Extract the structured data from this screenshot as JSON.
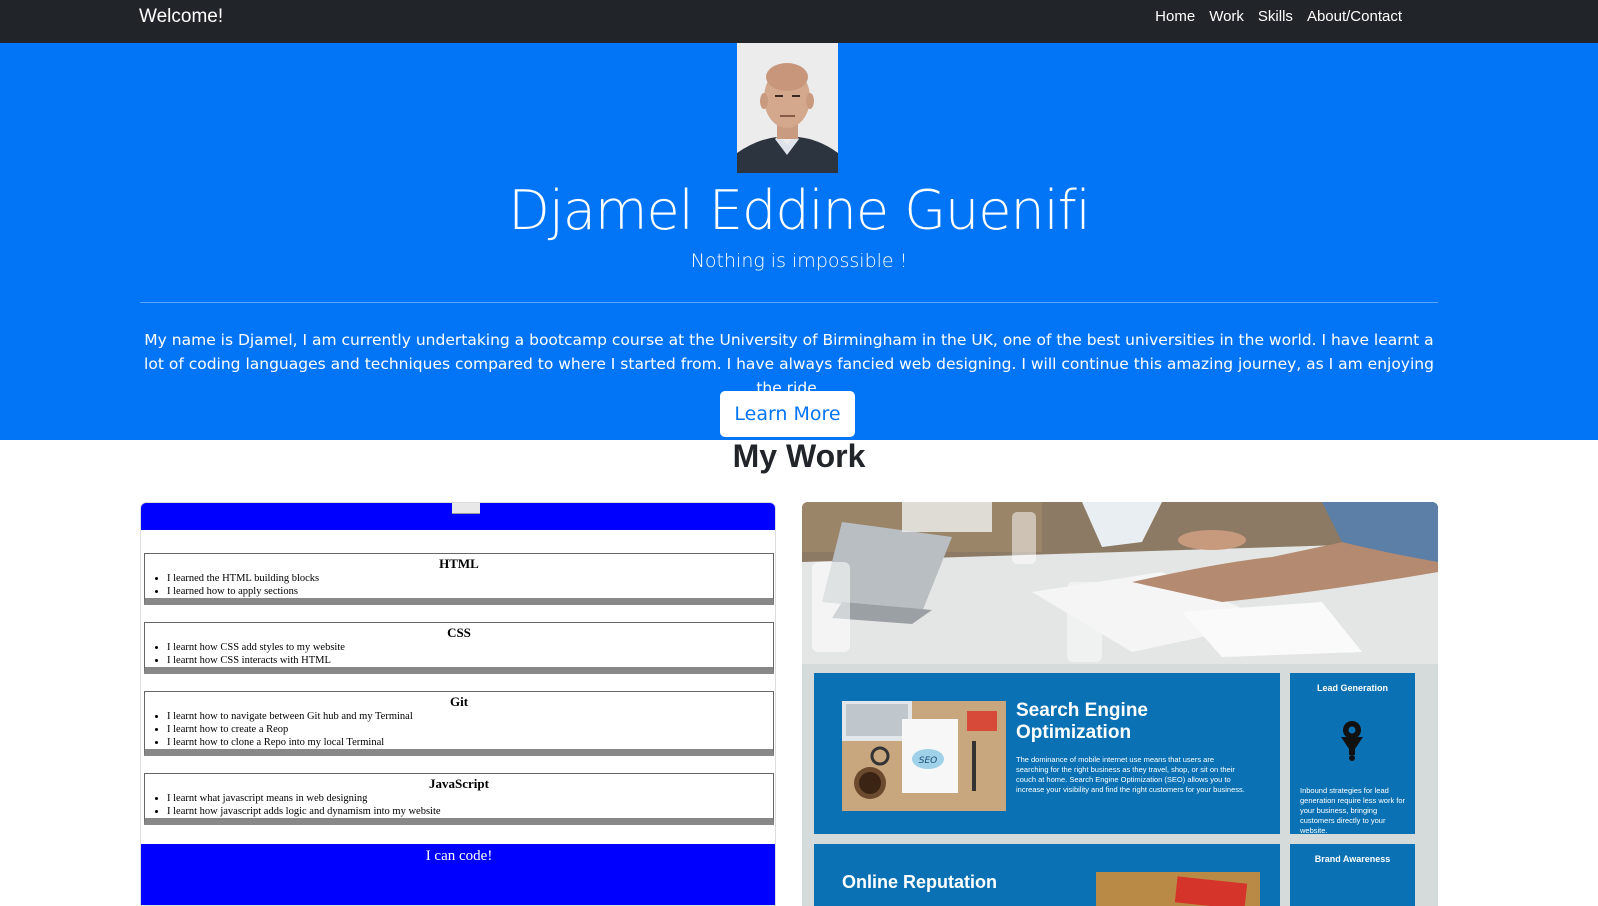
{
  "nav": {
    "brand": "Welcome!",
    "links": [
      "Home",
      "Work",
      "Skills",
      "About/Contact"
    ]
  },
  "hero": {
    "name": "Djamel Eddine Guenifi",
    "tagline": "Nothing is impossible !",
    "bio": "My name is Djamel, I am currently undertaking a bootcamp course at the University of Birmingham in the UK, one of the best universities in the world. I have learnt a lot of coding languages and techniques compared to where I started from. I have always fancied web designing. I will continue this amazing journey, as I am enjoying the ride.",
    "button": "Learn More",
    "colors": {
      "primary": "#0275f7",
      "navbar": "#212529"
    }
  },
  "work": {
    "title": "My Work",
    "skills_preview": {
      "sections": [
        {
          "title": "HTML",
          "items": [
            "I learned the HTML building blocks",
            "I learned how to apply sections"
          ]
        },
        {
          "title": "CSS",
          "items": [
            "I learnt how CSS add styles to my website",
            "I learnt how CSS interacts with HTML"
          ]
        },
        {
          "title": "Git",
          "items": [
            "I learnt how to navigate between Git hub and my Terminal",
            "I learnt how to create a Reop",
            "I learnt how to clone a Repo into my local Terminal"
          ]
        },
        {
          "title": "JavaScript",
          "items": [
            "I learnt what javascript means in web designing",
            "I learnt how javascript adds logic and dynamism into my website"
          ]
        }
      ],
      "footer": "I can code!"
    },
    "marketing_preview": {
      "seo_title": "Search Engine Optimization",
      "seo_text": "The dominance of mobile internet use means that users are searching for the right business as they travel, shop, or sit on their couch at home. Search Engine Optimization (SEO) allows you to increase your visibility and find the right customers for your business.",
      "lead_title": "Lead Generation",
      "lead_text": "Inbound strategies for lead generation require less work for your business, bringing customers directly to your website.",
      "brand_title": "Brand Awareness",
      "reputation_title": "Online Reputation",
      "seo_badge": "SEO"
    }
  }
}
